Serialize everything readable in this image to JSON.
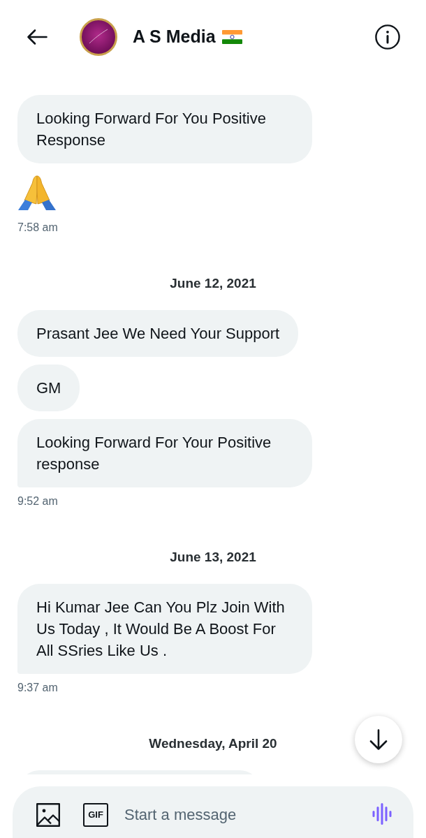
{
  "header": {
    "title": "A S Media"
  },
  "items": [
    {
      "kind": "text_bubble",
      "text": "Looking Forward For You Positive Response",
      "tail": false
    },
    {
      "kind": "emoji_bubble"
    },
    {
      "kind": "timestamp",
      "text": "7:58 am"
    },
    {
      "kind": "date_divider",
      "text": "June 12, 2021"
    },
    {
      "kind": "text_bubble",
      "text": "Prasant Jee We Need Your Support",
      "tail": false
    },
    {
      "kind": "text_bubble",
      "text": "GM",
      "tail": false
    },
    {
      "kind": "text_bubble",
      "text": "Looking Forward For Your Positive response",
      "tail": true
    },
    {
      "kind": "timestamp",
      "text": "9:52 am"
    },
    {
      "kind": "date_divider",
      "text": "June 13, 2021"
    },
    {
      "kind": "text_bubble",
      "text": "Hi Kumar Jee Can You Plz Join With Us Today , It Would Be A Boost For All SSries Like Us .",
      "tail": true
    },
    {
      "kind": "timestamp",
      "text": "9:37 am"
    },
    {
      "kind": "date_divider",
      "text": "Wednesday, April 20"
    },
    {
      "kind": "partial_bubble"
    }
  ],
  "composer": {
    "gif_label": "GIF",
    "placeholder": "Start a message"
  }
}
